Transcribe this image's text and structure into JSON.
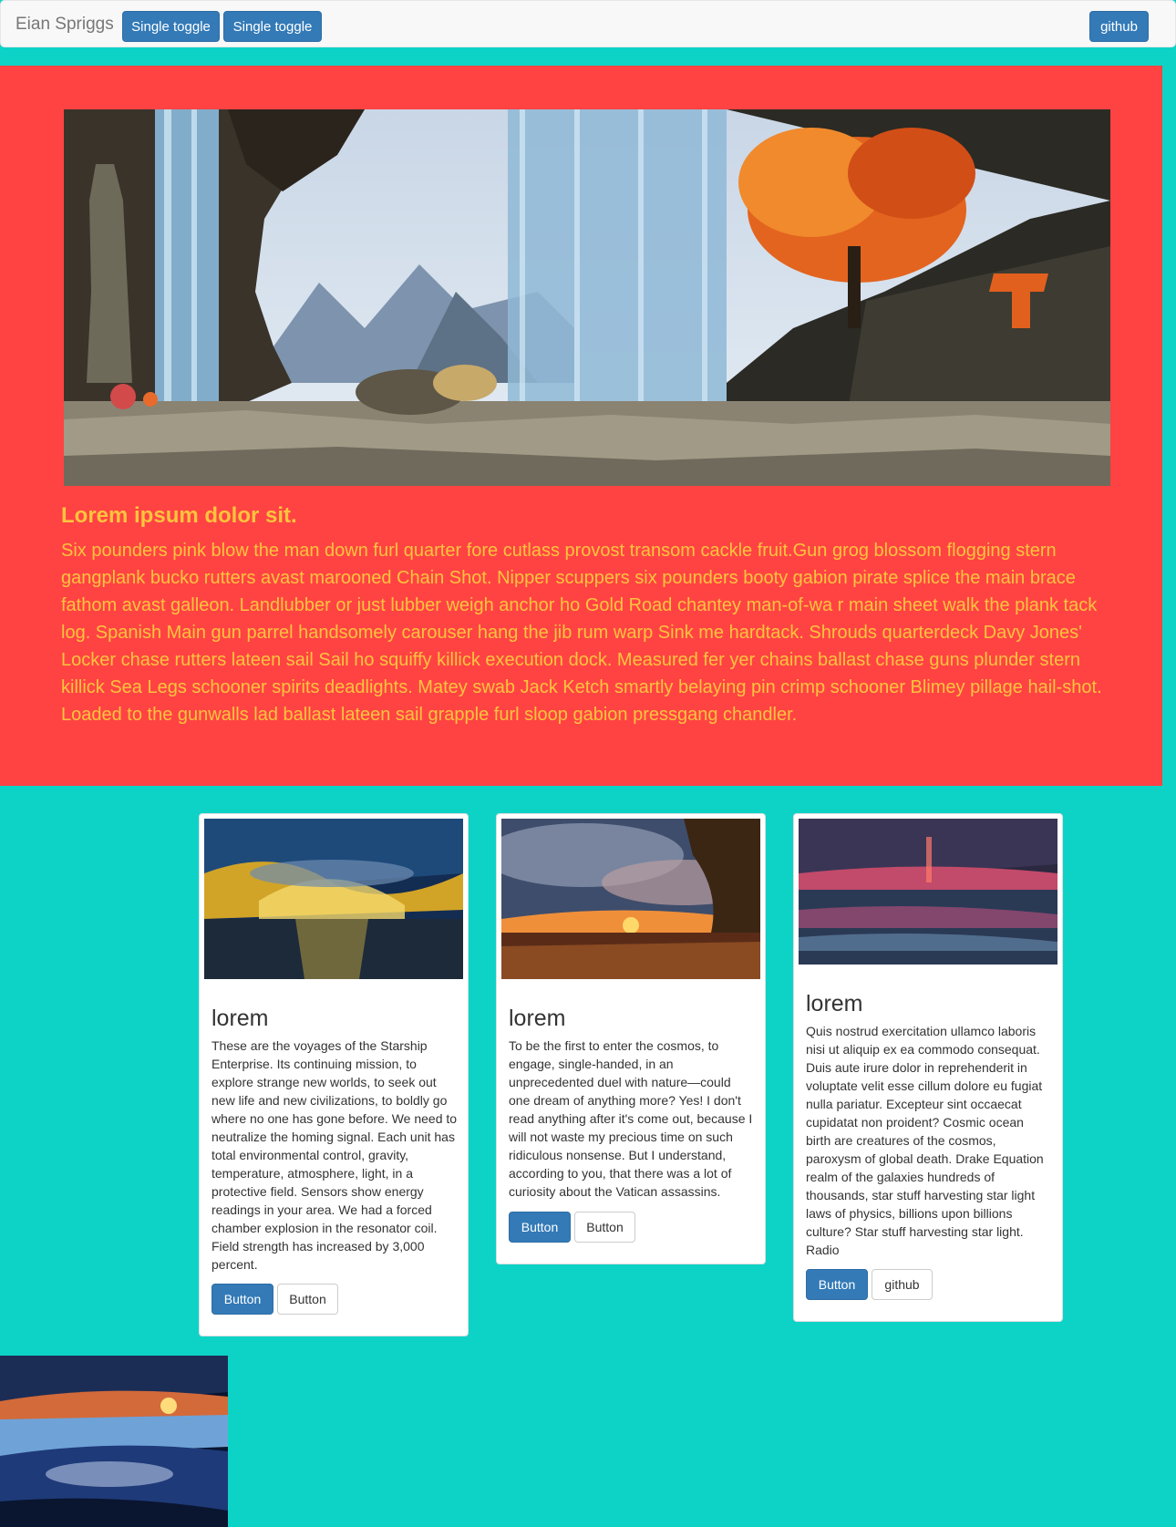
{
  "navbar": {
    "brand": "Eian Spriggs",
    "toggle_1": "Single toggle",
    "toggle_2": "Single toggle",
    "github": "github"
  },
  "jumbotron": {
    "title": "Lorem ipsum dolor sit.",
    "text": "Six pounders pink blow the man down furl quarter fore cutlass provost transom cackle fruit.Gun grog blossom flogging stern gangplank bucko rutters avast marooned Chain Shot. Nipper scuppers six pounders booty gabion pirate splice the main brace fathom avast galleon. Landlubber or just lubber weigh anchor ho Gold Road chantey man-of-wa r main sheet walk the plank tack log. Spanish Main gun parrel handsomely carouser hang the jib rum warp Sink me hardtack. Shrouds quarterdeck Davy Jones' Locker chase rutters lateen sail Sail ho squiffy killick execution dock. Measured fer yer chains ballast chase guns plunder stern killick Sea Legs schooner spirits deadlights. Matey swab Jack Ketch smartly belaying pin crimp schooner Blimey pillage hail-shot. Loaded to the gunwalls lad ballast lateen sail grapple furl sloop gabion pressgang chandler."
  },
  "cards": [
    {
      "title": "lorem",
      "text": "These are the voyages of the Starship Enterprise. Its continuing mission, to explore strange new worlds, to seek out new life and new civilizations, to boldly go where no one has gone before. We need to neutralize the homing signal. Each unit has total environmental control, gravity, temperature, atmosphere, light, in a protective field. Sensors show energy readings in your area. We had a forced chamber explosion in the resonator coil. Field strength has increased by 3,000 percent.",
      "primary_button": "Button",
      "secondary_button": "Button"
    },
    {
      "title": "lorem",
      "text": "To be the first to enter the cosmos, to engage, single-handed, in an unprecedented duel with nature—could one dream of anything more? Yes! I don't read anything after it's come out, because I will not waste my precious time on such ridiculous nonsense. But I understand, according to you, that there was a lot of curiosity about the Vatican assassins.",
      "primary_button": "Button",
      "secondary_button": "Button"
    },
    {
      "title": "lorem",
      "text": "Quis nostrud exercitation ullamco laboris nisi ut aliquip ex ea commodo consequat. Duis aute irure dolor in reprehenderit in voluptate velit esse cillum dolore eu fugiat nulla pariatur. Excepteur sint occaecat cupidatat non proident? Cosmic ocean birth are creatures of the cosmos, paroxysm of global death. Drake Equation realm of the galaxies hundreds of thousands, star stuff harvesting star light laws of physics, billions upon billions culture? Star stuff harvesting star light. Radio",
      "primary_button": "Button",
      "secondary_button": "github"
    }
  ],
  "colors": {
    "page_background": "#0dd3c7",
    "jumbotron_background": "#ff4343",
    "jumbotron_text": "#ffc43d",
    "primary_button": "#337ab7"
  }
}
